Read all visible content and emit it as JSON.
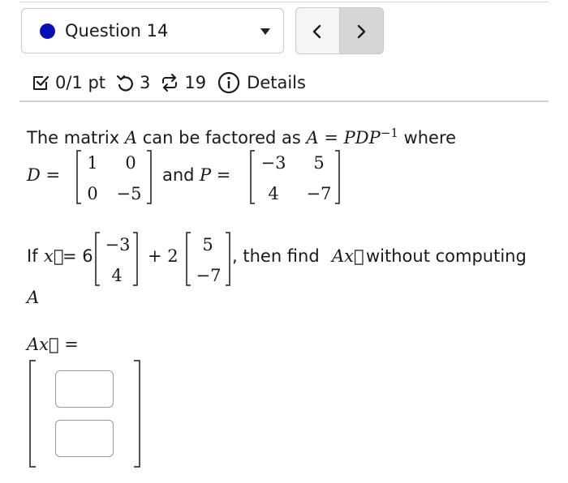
{
  "header": {
    "question_label": "Question 14",
    "prev_label": "<",
    "next_label": ">"
  },
  "meta": {
    "score": "0/1 pt",
    "retries": "3",
    "attempts": "19",
    "details": "Details"
  },
  "problem": {
    "line1": {
      "t1": "The matrix ",
      "A": "A",
      "t2": " can be factored as ",
      "eq": "A = PDP",
      "exp": "−1",
      "t3": " where"
    },
    "D_label": "D =",
    "and_label": "and",
    "P_label": "P =",
    "D": [
      [
        "1",
        "0"
      ],
      [
        "0",
        "−5"
      ]
    ],
    "P": [
      [
        "−3",
        "5"
      ],
      [
        "4",
        "−7"
      ]
    ],
    "if_label": "If",
    "x_vec": "x⃗",
    "eq_six": "= 6",
    "v1": [
      "−3",
      "4"
    ],
    "plus_two": "+ 2",
    "v2": [
      "5",
      "−7"
    ],
    "comma_text": ", then find",
    "Ax": "Ax⃗",
    "without_text": "without computing",
    "A_alone": "A"
  },
  "answer": {
    "label": "Ax⃗ ="
  }
}
